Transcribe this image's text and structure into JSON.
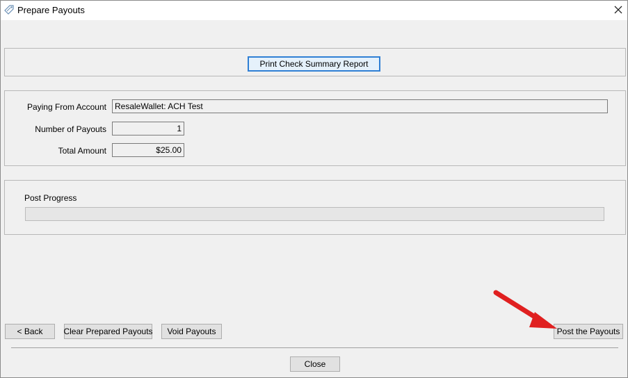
{
  "window": {
    "title": "Prepare Payouts",
    "icon": "payout-tag-icon",
    "close_icon": "close-icon"
  },
  "report": {
    "print_button_label": "Print Check Summary Report"
  },
  "summary": {
    "paying_from_label": "Paying From Account",
    "paying_from_value": "ResaleWallet: ACH Test",
    "number_of_payouts_label": "Number of Payouts",
    "number_of_payouts_value": "1",
    "total_amount_label": "Total Amount",
    "total_amount_value": "$25.00"
  },
  "progress": {
    "label": "Post Progress",
    "value_percent": 0
  },
  "actions": {
    "back_label": "< Back",
    "clear_label": "Clear Prepared Payouts",
    "void_label": "Void Payouts",
    "post_label": "Post the Payouts",
    "close_label": "Close"
  },
  "annotation": {
    "arrow_color": "#e02020",
    "focus_color": "#2f7fd4"
  }
}
